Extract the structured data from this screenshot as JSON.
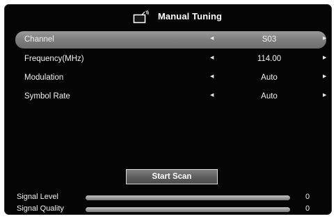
{
  "menu": {
    "title": "Manual Tuning",
    "title_icon": "tv-antenna-icon",
    "rows": [
      {
        "label": "Channel",
        "value": "S03",
        "selected": true
      },
      {
        "label": "Frequency(MHz)",
        "value": "114.00",
        "selected": false
      },
      {
        "label": "Modulation",
        "value": "Auto",
        "selected": false
      },
      {
        "label": "Symbol Rate",
        "value": "Auto",
        "selected": false
      }
    ],
    "arrow_left": "◀",
    "arrow_right": "▶"
  },
  "scan_button": {
    "label": "Start Scan"
  },
  "signal": {
    "level_label": "Signal Level",
    "level_value": "0",
    "quality_label": "Signal Quality",
    "quality_value": "0"
  },
  "colors": {
    "background": "#050505",
    "highlight": "#8a8a8a",
    "text": "#ffffff"
  }
}
